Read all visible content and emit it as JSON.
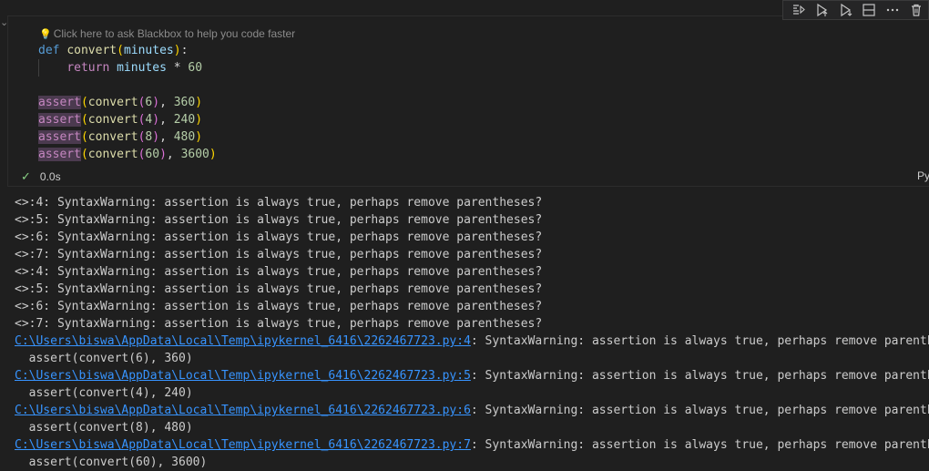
{
  "toolbar": {
    "icons": [
      "run-by-line-icon",
      "execute-above-icon",
      "execute-below-icon",
      "split-cell-icon",
      "more-icon",
      "delete-icon"
    ]
  },
  "cell": {
    "hint": "Click here to ask Blackbox to help you code faster",
    "code": {
      "line1": {
        "kw": "def",
        "fn": "convert",
        "param": "minutes"
      },
      "line2": {
        "kw": "return",
        "var": "minutes",
        "op": "*",
        "num": "60"
      },
      "asserts": [
        {
          "kw": "assert",
          "fn": "convert",
          "arg": "6",
          "val": "360"
        },
        {
          "kw": "assert",
          "fn": "convert",
          "arg": "4",
          "val": "240"
        },
        {
          "kw": "assert",
          "fn": "convert",
          "arg": "8",
          "val": "480"
        },
        {
          "kw": "assert",
          "fn": "convert",
          "arg": "60",
          "val": "3600"
        }
      ]
    },
    "exec_time": "0.0s",
    "language": "Py"
  },
  "output": {
    "warnings": [
      "<>:4: SyntaxWarning: assertion is always true, perhaps remove parentheses?",
      "<>:5: SyntaxWarning: assertion is always true, perhaps remove parentheses?",
      "<>:6: SyntaxWarning: assertion is always true, perhaps remove parentheses?",
      "<>:7: SyntaxWarning: assertion is always true, perhaps remove parentheses?",
      "<>:4: SyntaxWarning: assertion is always true, perhaps remove parentheses?",
      "<>:5: SyntaxWarning: assertion is always true, perhaps remove parentheses?",
      "<>:6: SyntaxWarning: assertion is always true, perhaps remove parentheses?",
      "<>:7: SyntaxWarning: assertion is always true, perhaps remove parentheses?"
    ],
    "traces": [
      {
        "link": "C:\\Users\\biswa\\AppData\\Local\\Temp\\ipykernel_6416\\2262467723.py:4",
        "msg": ": SyntaxWarning: assertion is always true, perhaps remove parentheses?",
        "src": "  assert(convert(6), 360)"
      },
      {
        "link": "C:\\Users\\biswa\\AppData\\Local\\Temp\\ipykernel_6416\\2262467723.py:5",
        "msg": ": SyntaxWarning: assertion is always true, perhaps remove parentheses?",
        "src": "  assert(convert(4), 240)"
      },
      {
        "link": "C:\\Users\\biswa\\AppData\\Local\\Temp\\ipykernel_6416\\2262467723.py:6",
        "msg": ": SyntaxWarning: assertion is always true, perhaps remove parentheses?",
        "src": "  assert(convert(8), 480)"
      },
      {
        "link": "C:\\Users\\biswa\\AppData\\Local\\Temp\\ipykernel_6416\\2262467723.py:7",
        "msg": ": SyntaxWarning: assertion is always true, perhaps remove parentheses?",
        "src": "  assert(convert(60), 3600)"
      }
    ]
  }
}
